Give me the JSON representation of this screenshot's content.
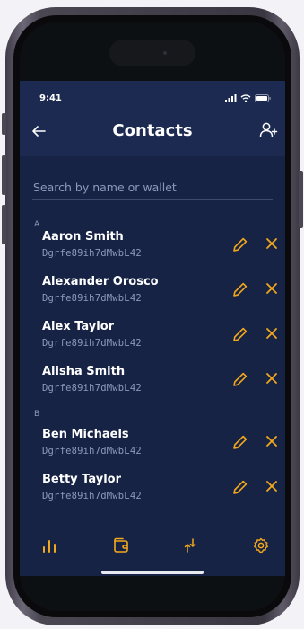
{
  "status_bar": {
    "time": "9:41"
  },
  "header": {
    "title": "Contacts"
  },
  "search": {
    "placeholder": "Search by name or wallet"
  },
  "sections": [
    {
      "letter": "A",
      "contacts": [
        {
          "name": "Aaron Smith",
          "wallet": "Dgrfe89ih7dMwbL42"
        },
        {
          "name": "Alexander Orosco",
          "wallet": "Dgrfe89ih7dMwbL42"
        },
        {
          "name": "Alex Taylor",
          "wallet": "Dgrfe89ih7dMwbL42"
        },
        {
          "name": "Alisha Smith",
          "wallet": "Dgrfe89ih7dMwbL42"
        }
      ]
    },
    {
      "letter": "B",
      "contacts": [
        {
          "name": "Ben Michaels",
          "wallet": "Dgrfe89ih7dMwbL42"
        },
        {
          "name": "Betty Taylor",
          "wallet": "Dgrfe89ih7dMwbL42"
        }
      ]
    }
  ],
  "icons": {
    "back": "arrow-left-icon",
    "add_contact": "add-user-icon",
    "edit": "pencil-icon",
    "delete": "close-x-icon",
    "tabs": [
      "bar-chart-icon",
      "wallet-icon",
      "transfer-arrows-icon",
      "settings-gear-icon"
    ]
  },
  "colors": {
    "app_background": "#172345",
    "header_background": "#1c2a52",
    "accent": "#f2a81d",
    "text_primary": "#ffffff",
    "text_secondary": "#8e99b8"
  }
}
